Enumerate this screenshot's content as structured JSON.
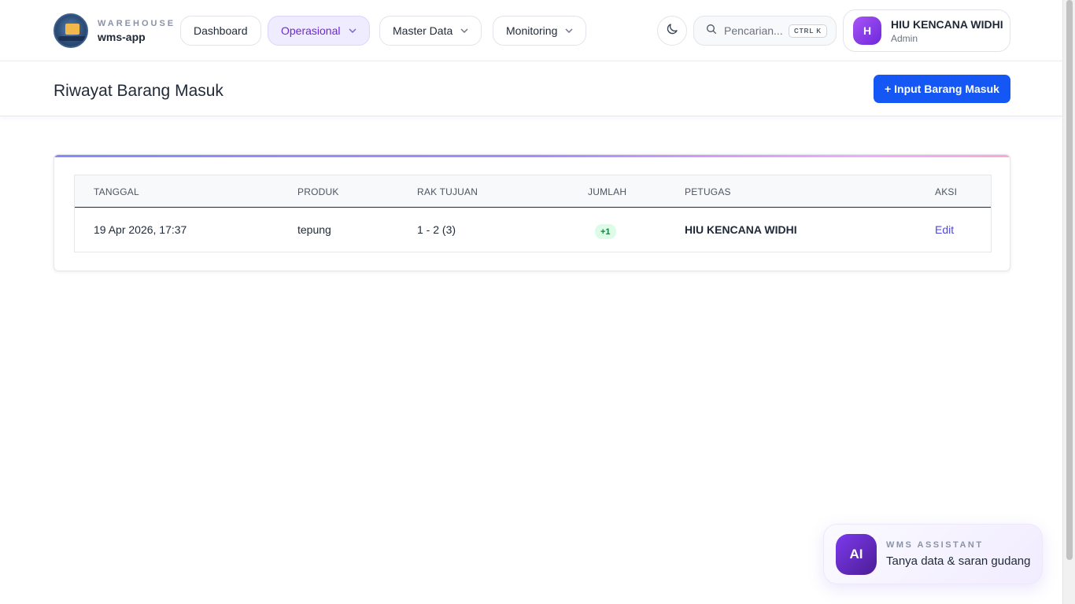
{
  "brand": {
    "top": "WAREHOUSE",
    "name": "wms-app"
  },
  "nav": {
    "dashboard": "Dashboard",
    "operasional": "Operasional",
    "master_data": "Master Data",
    "monitoring": "Monitoring",
    "active": "Operasional"
  },
  "search": {
    "placeholder": "Pencarian...",
    "shortcut": "CTRL K"
  },
  "user": {
    "initial": "H",
    "name": "HIU KENCANA WIDHI",
    "role": "Admin"
  },
  "page": {
    "title": "Riwayat Barang Masuk",
    "primary_button": "+ Input Barang Masuk"
  },
  "table": {
    "headers": {
      "tanggal": "TANGGAL",
      "produk": "PRODUK",
      "rak": "RAK TUJUAN",
      "jumlah": "JUMLAH",
      "petugas": "PETUGAS",
      "aksi": "AKSI"
    },
    "rows": [
      {
        "tanggal": "19 Apr 2026, 17:37",
        "produk": "tepung",
        "rak": "1 - 2 (3)",
        "jumlah": "+1",
        "petugas": "HIU KENCANA WIDHI",
        "aksi": "Edit"
      }
    ]
  },
  "assistant": {
    "badge": "AI",
    "title": "WMS ASSISTANT",
    "subtitle": "Tanya data & saran gudang"
  },
  "colors": {
    "primary": "#1557f5",
    "accent_purple": "#6d28d9",
    "success_bg": "#dcfce7",
    "success_text": "#15803d"
  }
}
